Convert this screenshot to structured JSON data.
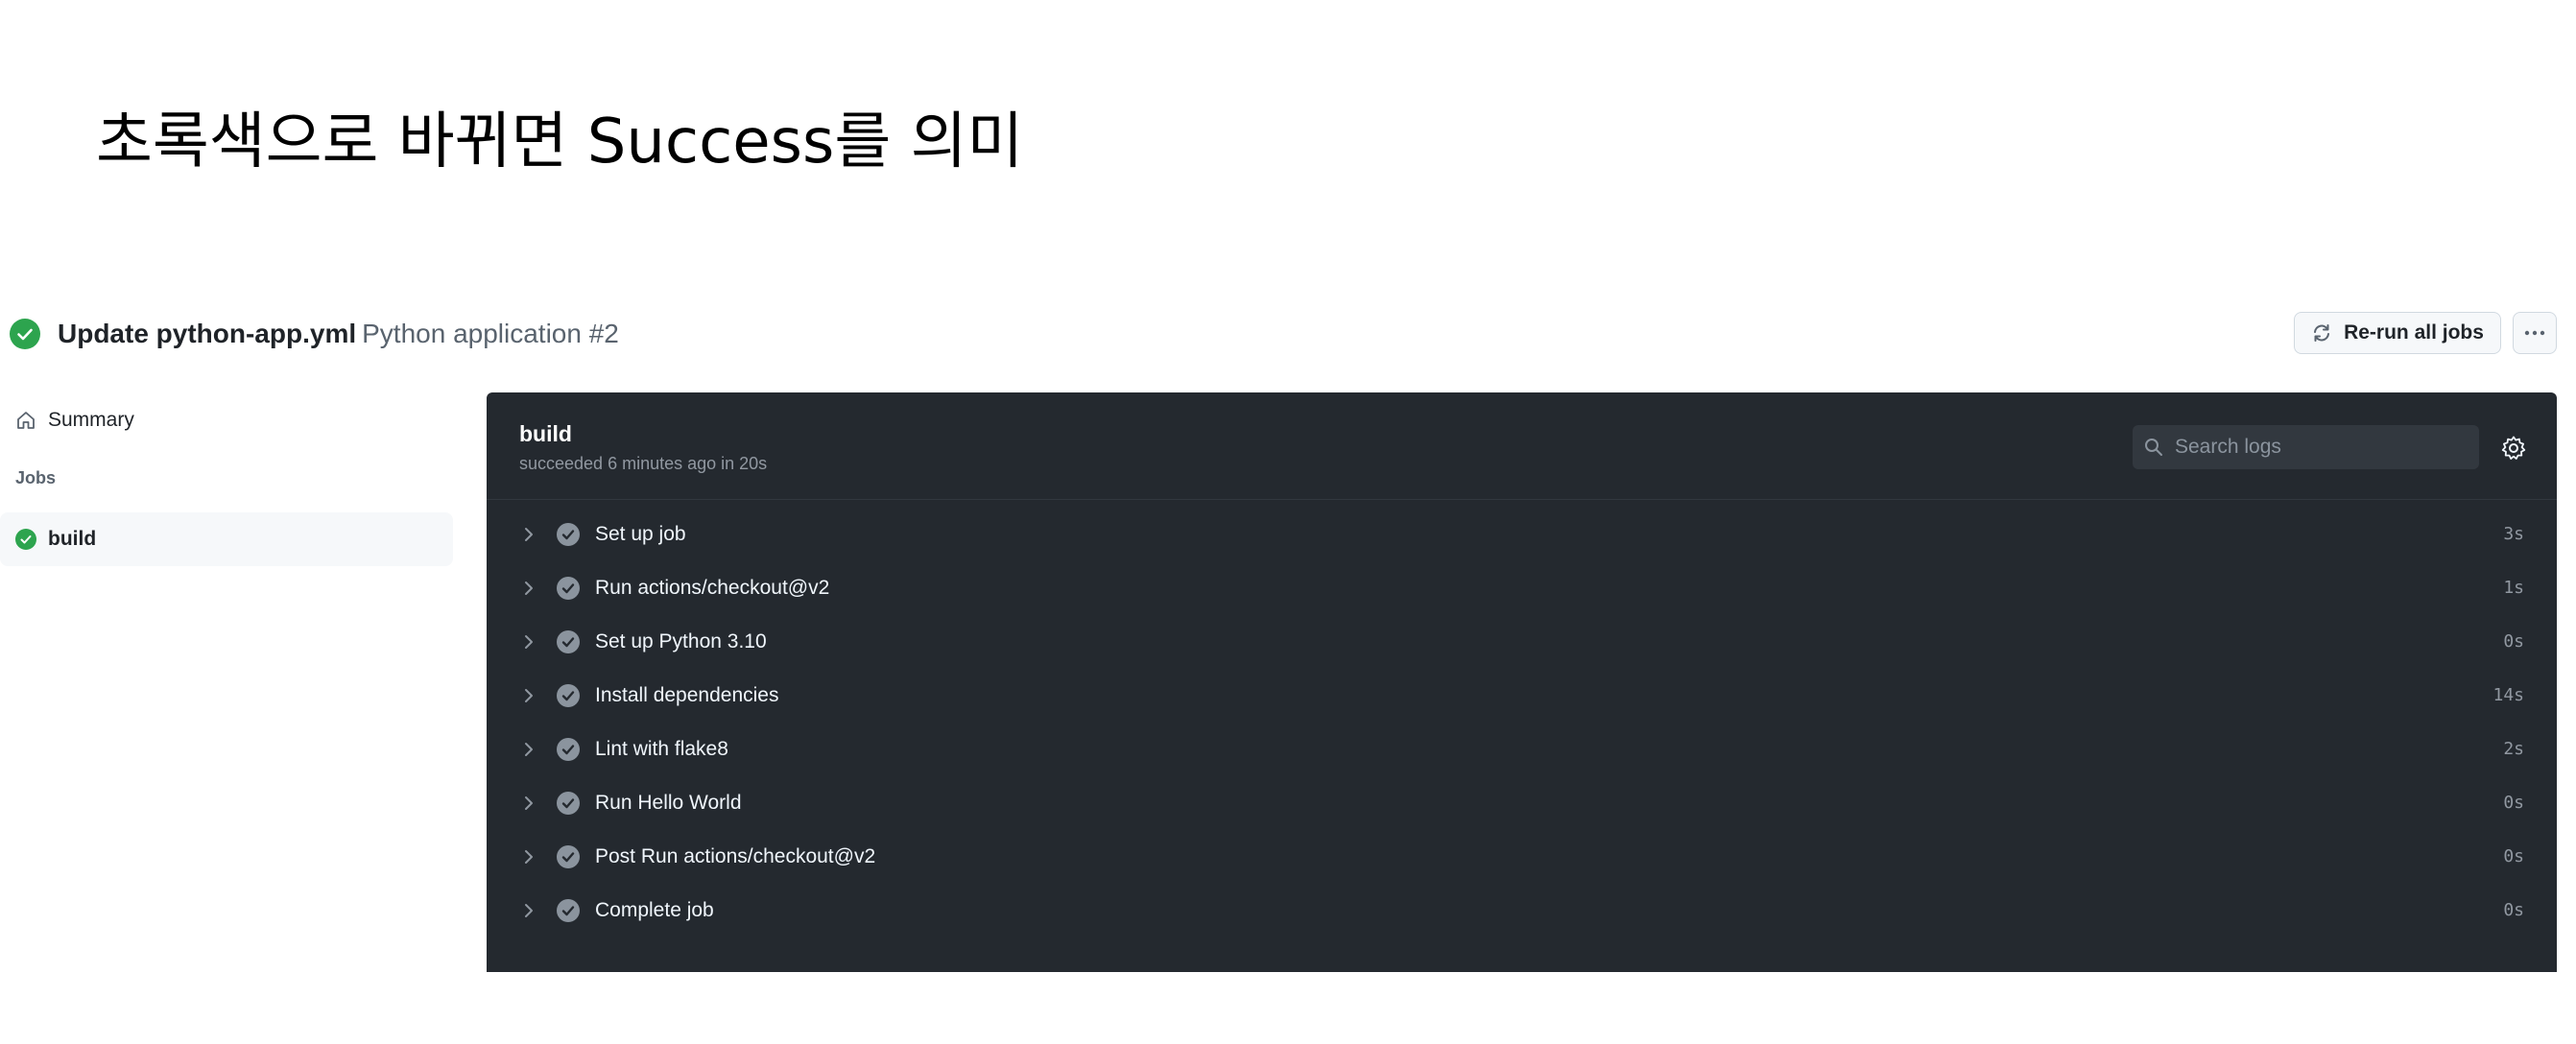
{
  "slide": {
    "title": "초록색으로 바뀌면 Success를 의미"
  },
  "colors": {
    "success": "#2da44e",
    "log_bg": "#24292f",
    "step_check": "#8b949e"
  },
  "run": {
    "status_icon": "check-circle-fill-icon",
    "commit_title": "Update python-app.yml",
    "workflow_label": "Python application #2",
    "rerun_label": "Re-run all jobs",
    "rerun_icon": "sync-icon",
    "more_icon": "kebab-horizontal-icon"
  },
  "sidebar": {
    "summary_label": "Summary",
    "summary_icon": "home-icon",
    "jobs_heading": "Jobs",
    "jobs": [
      {
        "label": "build",
        "status": "success"
      }
    ]
  },
  "log": {
    "job_name": "build",
    "job_meta": "succeeded 6 minutes ago in 20s",
    "search_placeholder": "Search logs",
    "search_icon": "search-icon",
    "settings_icon": "gear-icon",
    "steps": [
      {
        "name": "Set up job",
        "duration": "3s"
      },
      {
        "name": "Run actions/checkout@v2",
        "duration": "1s"
      },
      {
        "name": "Set up Python 3.10",
        "duration": "0s"
      },
      {
        "name": "Install dependencies",
        "duration": "14s"
      },
      {
        "name": "Lint with flake8",
        "duration": "2s"
      },
      {
        "name": "Run Hello World",
        "duration": "0s"
      },
      {
        "name": "Post Run actions/checkout@v2",
        "duration": "0s"
      },
      {
        "name": "Complete job",
        "duration": "0s"
      }
    ]
  }
}
